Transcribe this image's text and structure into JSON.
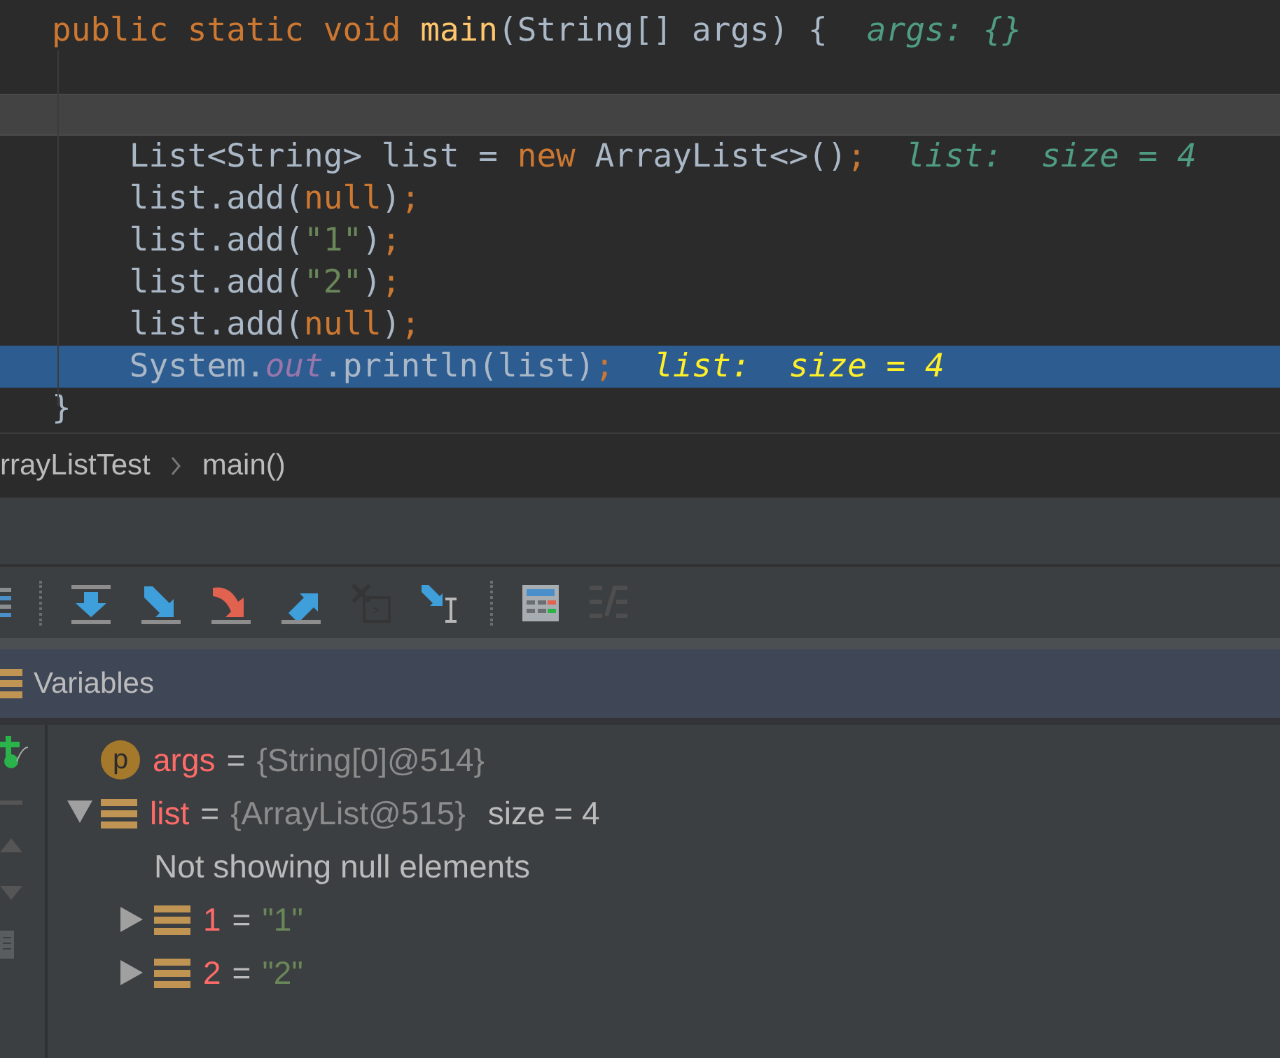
{
  "editor": {
    "lines": [
      {
        "current": false,
        "execution": false,
        "tokens": [
          {
            "kind": "keyword",
            "text": "public static void "
          },
          {
            "kind": "method",
            "text": "main"
          },
          {
            "kind": "plain",
            "text": "(String[] args) {"
          }
        ],
        "hint": "args: {}"
      },
      {
        "current": false,
        "execution": false
      },
      {
        "current": true,
        "execution": false
      },
      {
        "current": false,
        "execution": false,
        "tokens": [
          {
            "kind": "plain",
            "text": "    List<String> list = "
          },
          {
            "kind": "keyword",
            "text": "new"
          },
          {
            "kind": "plain",
            "text": " ArrayList<>()"
          },
          {
            "kind": "keyword",
            "text": ";"
          }
        ],
        "hint": "list:  size = 4"
      },
      {
        "current": false,
        "execution": false,
        "tokens": [
          {
            "kind": "plain",
            "text": "    list.add("
          },
          {
            "kind": "keyword",
            "text": "null"
          },
          {
            "kind": "plain",
            "text": ")"
          },
          {
            "kind": "keyword",
            "text": ";"
          }
        ]
      },
      {
        "current": false,
        "execution": false,
        "tokens": [
          {
            "kind": "plain",
            "text": "    list.add("
          },
          {
            "kind": "string",
            "text": "\"1\""
          },
          {
            "kind": "plain",
            "text": ")"
          },
          {
            "kind": "keyword",
            "text": ";"
          }
        ]
      },
      {
        "current": false,
        "execution": false,
        "tokens": [
          {
            "kind": "plain",
            "text": "    list.add("
          },
          {
            "kind": "string",
            "text": "\"2\""
          },
          {
            "kind": "plain",
            "text": ")"
          },
          {
            "kind": "keyword",
            "text": ";"
          }
        ]
      },
      {
        "current": false,
        "execution": false,
        "tokens": [
          {
            "kind": "plain",
            "text": "    list.add("
          },
          {
            "kind": "keyword",
            "text": "null"
          },
          {
            "kind": "plain",
            "text": ")"
          },
          {
            "kind": "keyword",
            "text": ";"
          }
        ]
      },
      {
        "current": false,
        "execution": true,
        "tokens": [
          {
            "kind": "plain",
            "text": "    System."
          },
          {
            "kind": "field",
            "text": "out"
          },
          {
            "kind": "plain",
            "text": ".println(list)"
          },
          {
            "kind": "keyword",
            "text": ";"
          }
        ],
        "hint": "list:  size = 4"
      },
      {
        "current": false,
        "execution": false,
        "tokens": [
          {
            "kind": "plain",
            "text": "}"
          }
        ]
      }
    ]
  },
  "breadcrumb": [
    "rrayListTest",
    "main()"
  ],
  "toolbar": [
    {
      "kind": "frames",
      "disabled": false
    },
    {
      "kind": "separator"
    },
    {
      "kind": "step-over",
      "disabled": false
    },
    {
      "kind": "step-into",
      "disabled": false
    },
    {
      "kind": "force-step-into",
      "disabled": false
    },
    {
      "kind": "step-out",
      "disabled": false
    },
    {
      "kind": "drop-frame",
      "disabled": true
    },
    {
      "kind": "run-to-cursor",
      "disabled": false
    },
    {
      "kind": "separator"
    },
    {
      "kind": "evaluate",
      "disabled": false
    },
    {
      "kind": "trace",
      "disabled": true
    }
  ],
  "variables": {
    "title": "Variables",
    "items": [
      {
        "kind": "param",
        "badge": "p",
        "name": "args",
        "op": "=",
        "value": {
          "kind": "object",
          "text": "{String[0]@514}"
        }
      },
      {
        "kind": "field",
        "name": "list",
        "op": "=",
        "value": {
          "kind": "object",
          "text": "{ArrayList@515}"
        },
        "extra": "size = 4",
        "expanded": true,
        "children": [
          {
            "kind": "note",
            "text": "Not showing null elements"
          },
          {
            "kind": "field",
            "name": "1",
            "op": "=",
            "value": {
              "kind": "string",
              "text": "\"1\""
            },
            "expanded": false
          },
          {
            "kind": "field",
            "name": "2",
            "op": "=",
            "value": {
              "kind": "string",
              "text": "\"2\""
            },
            "expanded": false
          }
        ]
      }
    ]
  }
}
